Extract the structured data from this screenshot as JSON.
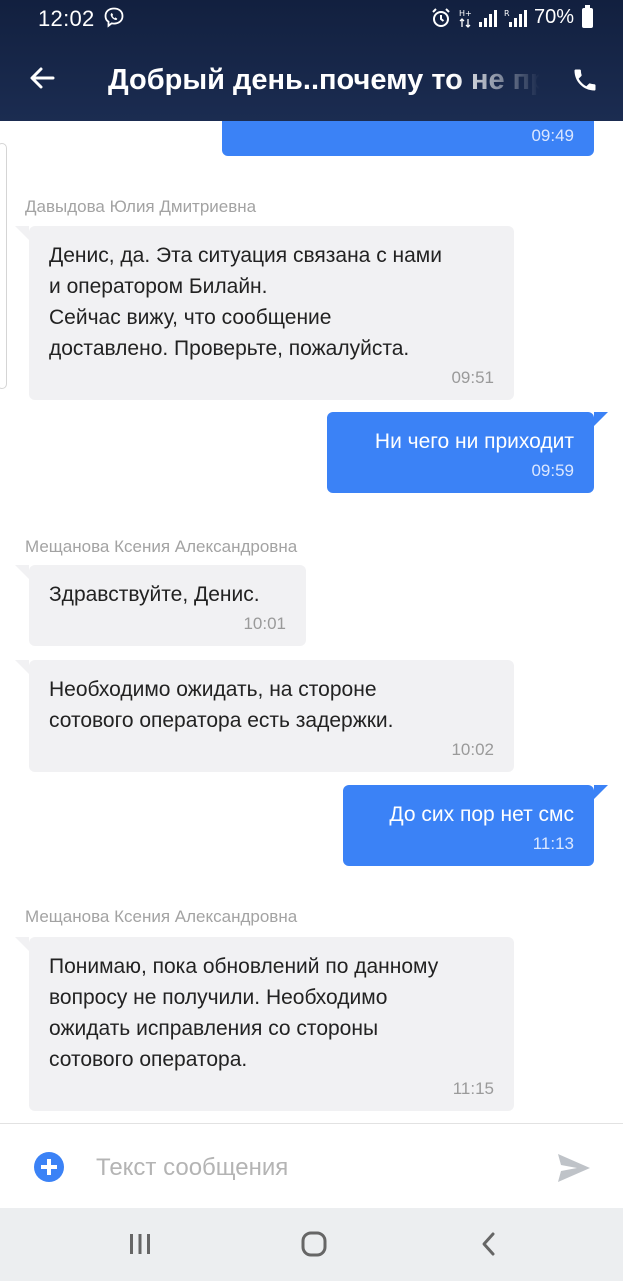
{
  "status_bar": {
    "time": "12:02",
    "battery": "70%",
    "icons": [
      "viber-icon",
      "alarm-icon",
      "data-arrows-icon",
      "signal-icon",
      "signal-r-icon",
      "battery-icon"
    ]
  },
  "header": {
    "title": "Добрый день..почему то не пр",
    "back_icon": "arrow-left-icon",
    "call_icon": "phone-icon"
  },
  "messages": [
    {
      "direction": "out",
      "text": "",
      "time": "09:49"
    },
    {
      "direction": "in",
      "sender": "Давыдова Юлия Дмитриевна",
      "text": "Денис, да. Эта ситуация связана с нами\nи оператором Билайн.\nСейчас вижу, что сообщение\nдоставлено. Проверьте, пожалуйста.",
      "time": "09:51"
    },
    {
      "direction": "out",
      "text": "Ни чего ни приходит",
      "time": "09:59"
    },
    {
      "direction": "in",
      "sender": "Мещанова Ксения Александровна",
      "text": "Здравствуйте, Денис.",
      "time": "10:01"
    },
    {
      "direction": "in",
      "text": "Необходимо ожидать, на стороне\nсотового оператора есть задержки.",
      "time": "10:02"
    },
    {
      "direction": "out",
      "text": "До сих пор нет смс",
      "time": "11:13"
    },
    {
      "direction": "in",
      "sender": "Мещанова Ксения Александровна",
      "text": "Понимаю, пока обновлений по данному\nвопросу не получили. Необходимо\nожидать исправления со стороны\nсотового оператора.",
      "time": "11:15"
    }
  ],
  "composer": {
    "placeholder": "Текст сообщения",
    "add_icon": "plus-circle-icon",
    "send_icon": "send-icon"
  },
  "navigation": {
    "buttons": [
      "recent-apps-icon",
      "home-icon",
      "back-nav-icon"
    ]
  },
  "colors": {
    "header_bg": "#1b2c51",
    "outgoing_bubble": "#3b82f6",
    "incoming_bubble": "#f1f1f3",
    "accent": "#3b82f6"
  }
}
